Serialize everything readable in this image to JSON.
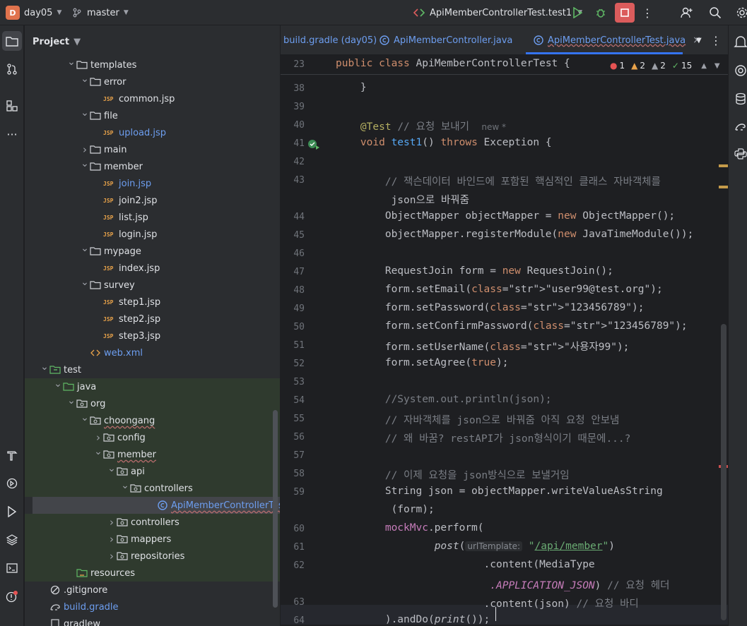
{
  "titlebar": {
    "project_badge": "D",
    "project_name": "day05",
    "branch": "master",
    "run_config": "ApiMemberControllerTest.test1"
  },
  "project_panel": {
    "title": "Project",
    "rows": [
      {
        "label": "templates",
        "kind": "folder",
        "indent": 4,
        "arrow": "open",
        "green": false
      },
      {
        "label": "error",
        "kind": "folder",
        "indent": 5,
        "arrow": "open",
        "green": false
      },
      {
        "label": "common.jsp",
        "kind": "jsp",
        "indent": 6,
        "arrow": "none",
        "green": false
      },
      {
        "label": "file",
        "kind": "folder",
        "indent": 5,
        "arrow": "open",
        "green": false
      },
      {
        "label": "upload.jsp",
        "kind": "jsp",
        "indent": 6,
        "arrow": "none",
        "green": false,
        "blue": true
      },
      {
        "label": "main",
        "kind": "folder",
        "indent": 5,
        "arrow": "closed",
        "green": false
      },
      {
        "label": "member",
        "kind": "folder",
        "indent": 5,
        "arrow": "open",
        "green": false
      },
      {
        "label": "join.jsp",
        "kind": "jsp",
        "indent": 6,
        "arrow": "none",
        "green": false,
        "blue": true
      },
      {
        "label": "join2.jsp",
        "kind": "jsp",
        "indent": 6,
        "arrow": "none",
        "green": false
      },
      {
        "label": "list.jsp",
        "kind": "jsp",
        "indent": 6,
        "arrow": "none",
        "green": false
      },
      {
        "label": "login.jsp",
        "kind": "jsp",
        "indent": 6,
        "arrow": "none",
        "green": false
      },
      {
        "label": "mypage",
        "kind": "folder",
        "indent": 5,
        "arrow": "open",
        "green": false
      },
      {
        "label": "index.jsp",
        "kind": "jsp",
        "indent": 6,
        "arrow": "none",
        "green": false
      },
      {
        "label": "survey",
        "kind": "folder",
        "indent": 5,
        "arrow": "open",
        "green": false
      },
      {
        "label": "step1.jsp",
        "kind": "jsp",
        "indent": 6,
        "arrow": "none",
        "green": false
      },
      {
        "label": "step2.jsp",
        "kind": "jsp",
        "indent": 6,
        "arrow": "none",
        "green": false
      },
      {
        "label": "step3.jsp",
        "kind": "jsp",
        "indent": 6,
        "arrow": "none",
        "green": false
      },
      {
        "label": "web.xml",
        "kind": "xml",
        "indent": 5,
        "arrow": "none",
        "green": false,
        "blue": true
      },
      {
        "label": "test",
        "kind": "test-folder",
        "indent": 2,
        "arrow": "open",
        "green": false
      },
      {
        "label": "java",
        "kind": "src-folder",
        "indent": 3,
        "arrow": "open",
        "green": true
      },
      {
        "label": "org",
        "kind": "package",
        "indent": 4,
        "arrow": "open",
        "green": true
      },
      {
        "label": "choongang",
        "kind": "package",
        "indent": 5,
        "arrow": "open",
        "green": true
      },
      {
        "label": "config",
        "kind": "package",
        "indent": 6,
        "arrow": "closed",
        "green": true
      },
      {
        "label": "member",
        "kind": "package",
        "indent": 6,
        "arrow": "open",
        "green": true
      },
      {
        "label": "api",
        "kind": "package",
        "indent": 7,
        "arrow": "open",
        "green": true
      },
      {
        "label": "controllers",
        "kind": "package",
        "indent": 8,
        "arrow": "open",
        "green": true
      },
      {
        "label": "ApiMemberControllerTest",
        "kind": "class",
        "indent": 10,
        "arrow": "none",
        "green": true,
        "selected": true,
        "blue": true
      },
      {
        "label": "controllers",
        "kind": "package",
        "indent": 7,
        "arrow": "closed",
        "green": true
      },
      {
        "label": "mappers",
        "kind": "package",
        "indent": 7,
        "arrow": "closed",
        "green": true
      },
      {
        "label": "repositories",
        "kind": "package",
        "indent": 7,
        "arrow": "closed",
        "green": true
      },
      {
        "label": "resources",
        "kind": "res-folder",
        "indent": 4,
        "arrow": "none",
        "green": true
      },
      {
        "label": ".gitignore",
        "kind": "gitignore",
        "indent": 2,
        "arrow": "none",
        "green": false
      },
      {
        "label": "build.gradle",
        "kind": "gradle",
        "indent": 2,
        "arrow": "none",
        "green": false,
        "blue": true
      },
      {
        "label": "gradlew",
        "kind": "file",
        "indent": 2,
        "arrow": "none",
        "green": false
      }
    ]
  },
  "tabs": [
    {
      "label": "build.gradle (day05)",
      "icon": "gradle-icon"
    },
    {
      "label": "ApiMemberController.java",
      "icon": "class-icon"
    },
    {
      "label": "ApiMemberControllerTest.java",
      "icon": "class-icon",
      "active": true
    }
  ],
  "inspections": {
    "errors": "1",
    "warnings": "2",
    "weak_warnings": "2",
    "ok": "15"
  },
  "editor": {
    "sticky": {
      "ln": "23",
      "text": "public class ApiMemberControllerTest {"
    },
    "lines": [
      {
        "ln": "38",
        "t": "    }"
      },
      {
        "ln": "39",
        "t": ""
      },
      {
        "ln": "40",
        "t": "    @Test // 요청 보내기",
        "hint": "new *"
      },
      {
        "ln": "41",
        "t": "    void test1() throws Exception {"
      },
      {
        "ln": "42",
        "t": ""
      },
      {
        "ln": "43",
        "t": "        // 잭슨데이터 바인드에 포함된 핵심적인 클래스 자바객체를"
      },
      {
        "ln": "",
        "t": "         json으로 바꿔줌"
      },
      {
        "ln": "44",
        "t": "        ObjectMapper objectMapper = new ObjectMapper();"
      },
      {
        "ln": "45",
        "t": "        objectMapper.registerModule(new JavaTimeModule());"
      },
      {
        "ln": "46",
        "t": ""
      },
      {
        "ln": "47",
        "t": "        RequestJoin form = new RequestJoin();"
      },
      {
        "ln": "48",
        "t": "        form.setEmail(\"user99@test.org\");"
      },
      {
        "ln": "49",
        "t": "        form.setPassword(\"123456789\");"
      },
      {
        "ln": "50",
        "t": "        form.setConfirmPassword(\"123456789\");"
      },
      {
        "ln": "51",
        "t": "        form.setUserName(\"사용자99\");"
      },
      {
        "ln": "52",
        "t": "        form.setAgree(true);"
      },
      {
        "ln": "53",
        "t": ""
      },
      {
        "ln": "54",
        "t": "        //System.out.println(json);"
      },
      {
        "ln": "55",
        "t": "        // 자바객체를 json으로 바꿔줌 아직 요청 안보냄"
      },
      {
        "ln": "56",
        "t": "        // 왜 바꿈? restAPI가 json형식이기 때문에...?"
      },
      {
        "ln": "57",
        "t": ""
      },
      {
        "ln": "58",
        "t": "        // 이제 요청을 json방식으로 보낼거임"
      },
      {
        "ln": "59",
        "t": "        String json = objectMapper.writeValueAsString"
      },
      {
        "ln": "",
        "t": "         (form);"
      },
      {
        "ln": "60",
        "t": "        mockMvc.perform("
      },
      {
        "ln": "61",
        "t": "                post(",
        "hint": "urlTemplate:",
        "rest": " \"/api/member\")"
      },
      {
        "ln": "62",
        "t": "                        .content(MediaType"
      },
      {
        "ln": "",
        "t": "                         .APPLICATION_JSON) // 요청 헤더"
      },
      {
        "ln": "63",
        "t": "                        .content(json) // 요청 바디"
      },
      {
        "ln": "64",
        "t": "        ).andDo(print());"
      }
    ]
  }
}
